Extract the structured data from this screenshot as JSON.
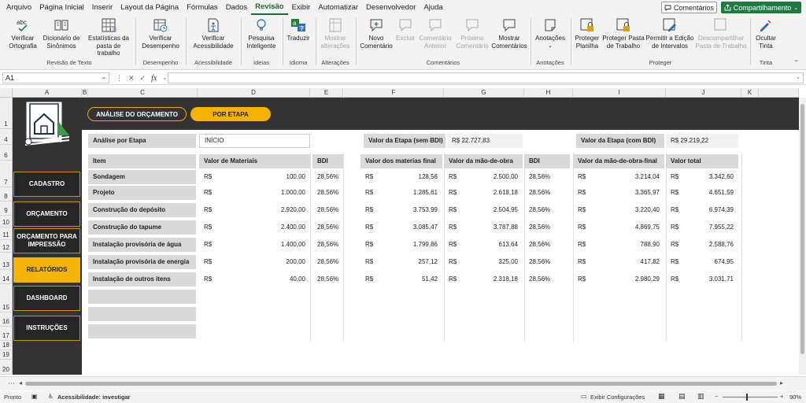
{
  "menu": {
    "tabs": [
      "Arquivo",
      "Página Inicial",
      "Inserir",
      "Layout da Página",
      "Fórmulas",
      "Dados",
      "Revisão",
      "Exibir",
      "Automatizar",
      "Desenvolvedor",
      "Ajuda"
    ],
    "active_tab": "Revisão",
    "comments_label": "Comentários",
    "share_label": "Compartilhamento"
  },
  "ribbon": {
    "buttons": {
      "spelling": "Verificar Ortografia",
      "thesaurus": "Dicionário de Sinônimos",
      "workbook_stats": "Estatísticas da pasta de trabalho",
      "check_perf": "Verificar Desempenho",
      "check_access": "Verificar Acessibilidade",
      "smart_lookup": "Pesquisa Inteligente",
      "translate": "Traduzir",
      "show_changes": "Mostrar alterações",
      "new_comment": "Novo Comentário",
      "delete": "Excluir",
      "prev_comment": "Comentário Anterior",
      "next_comment": "Próximo Comentário",
      "show_comments": "Mostrar Comentários",
      "notes": "Anotações",
      "protect_sheet": "Proteger Planilha",
      "protect_workbook": "Proteger Pasta de Trabalho",
      "allow_edit_ranges": "Permitir a Edição de Intervalos",
      "unshare_workbook": "Descompartilhar Pasta de Trabalho",
      "hide_ink": "Ocultar Tinta"
    },
    "groups": {
      "proofing": "Revisão de Texto",
      "performance": "Desempenho",
      "accessibility": "Acessibilidade",
      "insights": "Ideias",
      "language": "Idioma",
      "changes": "Alterações",
      "comments": "Comentários",
      "notes": "Anotações",
      "protect": "Proteger",
      "ink": "Tinta"
    }
  },
  "formula_bar": {
    "cell_ref": "A1",
    "fx": "fx",
    "value": ""
  },
  "columns": [
    "A",
    "B",
    "C",
    "D",
    "E",
    "F",
    "G",
    "H",
    "I",
    "J",
    "K"
  ],
  "rows": [
    "1",
    "4",
    "6",
    "7",
    "8",
    "9",
    "10",
    "11",
    "12",
    "13",
    "14",
    "15",
    "16",
    "17",
    "18",
    "19",
    "20"
  ],
  "sheet": {
    "pills": {
      "budget_analysis": "ANÁLISE DO ORÇAMENTO",
      "by_stage": "POR ETAPA"
    },
    "nav": [
      "CADASTRO",
      "ORÇAMENTO",
      "ORÇAMENTO PARA IMPRESSÃO",
      "RELATÓRIOS",
      "DASHBOARD",
      "INSTRUÇÕES"
    ],
    "nav_active": "RELATÓRIOS",
    "stage_label": "Análise por Etapa",
    "stage_value": "INÍCIO",
    "stage_total_no_bdi_label": "Valor da Etapa (sem BDI)",
    "stage_total_no_bdi_value": "R$ 22.727,83",
    "stage_total_bdi_label": "Valor da Etapa (com BDI)",
    "stage_total_bdi_value": "R$ 29.219,22",
    "table_headers": [
      "Item",
      "Valor de Materiais",
      "BDI",
      "Valor dos materias final",
      "Valor da mão-de-obra",
      "BDI",
      "Valor da mão-de-obra-final",
      "Valor total"
    ],
    "currency": "R$",
    "table_rows": [
      [
        "Sondagem",
        "100,00",
        "28,56%",
        "128,56",
        "2.500,00",
        "28,56%",
        "3.214,04",
        "3.342,60"
      ],
      [
        "Projeto",
        "1.000,00",
        "28,56%",
        "1.285,61",
        "2.618,18",
        "28,56%",
        "3.365,97",
        "4.651,59"
      ],
      [
        "Construção do depósito",
        "2.920,00",
        "28,56%",
        "3.753,99",
        "2.504,95",
        "28,56%",
        "3.220,40",
        "6.974,39"
      ],
      [
        "Construção do tapume",
        "2.400,00",
        "28,56%",
        "3.085,47",
        "3.787,88",
        "28,56%",
        "4.869,75",
        "7.955,22"
      ],
      [
        "Instalação provisória de água",
        "1.400,00",
        "28,56%",
        "1.799,86",
        "613,64",
        "28,56%",
        "788,90",
        "2.588,76"
      ],
      [
        "Instalação provisória de energia",
        "200,00",
        "28,56%",
        "257,12",
        "325,00",
        "28,56%",
        "417,82",
        "674,95"
      ],
      [
        "Instalação de outros itens",
        "40,00",
        "28,56%",
        "51,42",
        "2.318,18",
        "28,56%",
        "2.980,29",
        "3.031,71"
      ]
    ]
  },
  "status": {
    "ready": "Pronto",
    "accessibility": "Acessibilidade: investigar",
    "display_settings": "Exibir Configurações",
    "zoom": "90%"
  }
}
